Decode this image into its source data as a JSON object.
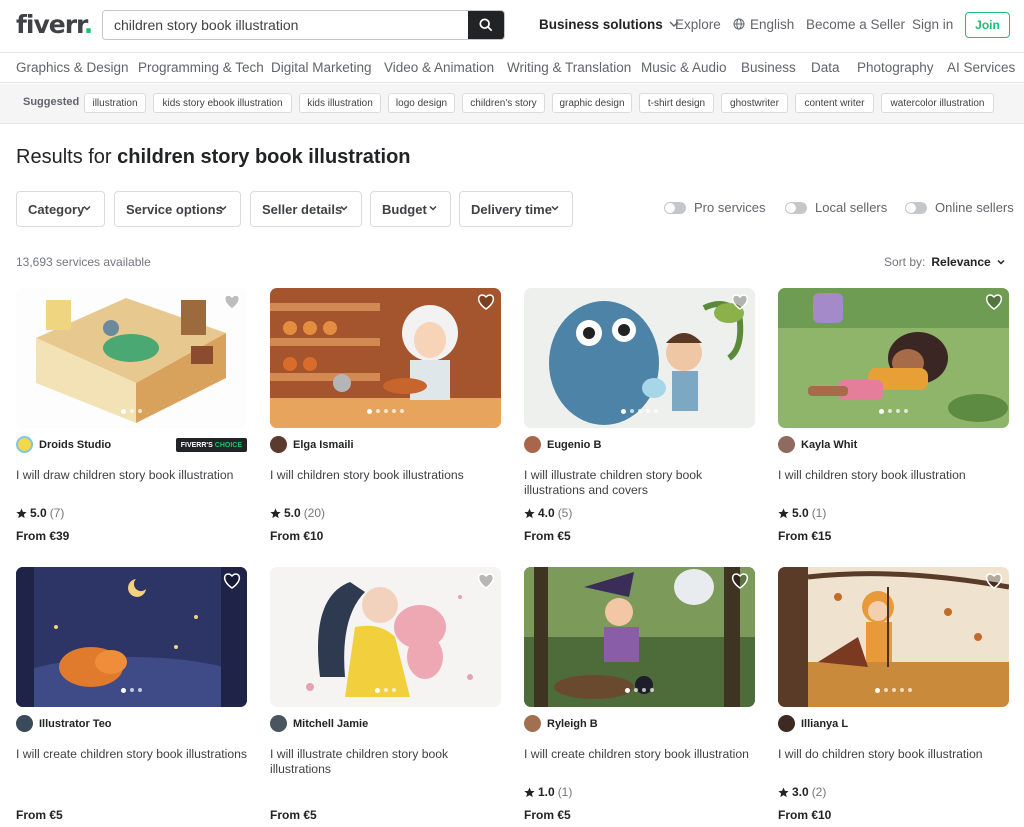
{
  "header": {
    "logo": "fiverr",
    "logo_dot": ".",
    "search_value": "children story book illustration",
    "business": "Business solutions",
    "explore": "Explore",
    "language": "English",
    "become_seller": "Become a Seller",
    "sign_in": "Sign in",
    "join": "Join"
  },
  "categories": [
    "Graphics & Design",
    "Programming & Tech",
    "Digital Marketing",
    "Video & Animation",
    "Writing & Translation",
    "Music & Audio",
    "Business",
    "Data",
    "Photography",
    "AI Services"
  ],
  "suggested": {
    "label": "Suggested",
    "chips": [
      "illustration",
      "kids story ebook illustration",
      "kids illustration",
      "logo design",
      "children's story",
      "graphic design",
      "t-shirt design",
      "ghostwriter",
      "content writer",
      "watercolor illustration"
    ]
  },
  "results": {
    "prefix": "Results for",
    "query": "children story book illustration"
  },
  "filters": [
    "Category",
    "Service options",
    "Seller details",
    "Budget",
    "Delivery time"
  ],
  "toggles": [
    "Pro services",
    "Local sellers",
    "Online sellers"
  ],
  "count": "13,693 services available",
  "sort": {
    "label": "Sort by:",
    "value": "Relevance"
  },
  "badge": {
    "part1": "FIVERR'S",
    "part2": "CHOICE"
  },
  "cards": [
    {
      "seller": "Droids Studio",
      "title": "I will draw children story book illustration",
      "rating": "5.0",
      "reviews": "(7)",
      "price": "From €39",
      "choice": true
    },
    {
      "seller": "Elga Ismaili",
      "title": "I will children story book illustrations",
      "rating": "5.0",
      "reviews": "(20)",
      "price": "From €10"
    },
    {
      "seller": "Eugenio B",
      "title": "I will illustrate children story book illustrations and covers",
      "rating": "4.0",
      "reviews": "(5)",
      "price": "From €5"
    },
    {
      "seller": "Kayla Whit",
      "title": "I will children story book illustration",
      "rating": "5.0",
      "reviews": "(1)",
      "price": "From €15"
    },
    {
      "seller": "Illustrator Teo",
      "title": "I will create children story book illustrations",
      "price": "From €5"
    },
    {
      "seller": "Mitchell Jamie",
      "title": "I will illustrate children story book illustrations",
      "price": "From €5"
    },
    {
      "seller": "Ryleigh B",
      "title": "I will create children story book illustration",
      "rating": "1.0",
      "reviews": "(1)",
      "price": "From €5"
    },
    {
      "seller": "Illianya L",
      "title": "I will do children story book illustration",
      "rating": "3.0",
      "reviews": "(2)",
      "price": "From €10"
    }
  ],
  "colors": {
    "brand": "#1dbf73",
    "text": "#404145",
    "dark": "#222325"
  }
}
